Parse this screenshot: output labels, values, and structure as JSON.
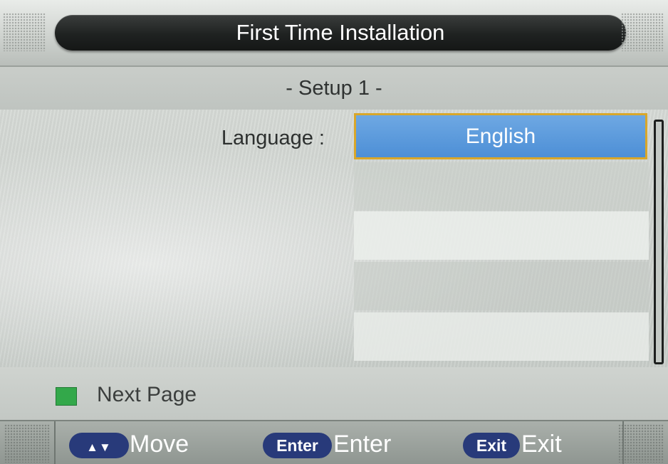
{
  "header": {
    "title": "First Time Installation"
  },
  "setup": {
    "subtitle": "- Setup 1 -",
    "language_label": "Language :",
    "language_value": "English"
  },
  "footer": {
    "color_key": {
      "color": "#33a84a",
      "icon": "green-key-icon",
      "label": "Next Page"
    }
  },
  "helpbar": {
    "move": {
      "key_icon": "up-down-arrows-icon",
      "key_symbol": "▲▼",
      "label": "Move"
    },
    "enter": {
      "key_label": "Enter",
      "label": "Enter"
    },
    "exit": {
      "key_label": "Exit",
      "label": "Exit"
    }
  },
  "colors": {
    "selection_fill": "#5a9be0",
    "selection_border": "#d9a72a",
    "key_fill": "#283a7a"
  }
}
